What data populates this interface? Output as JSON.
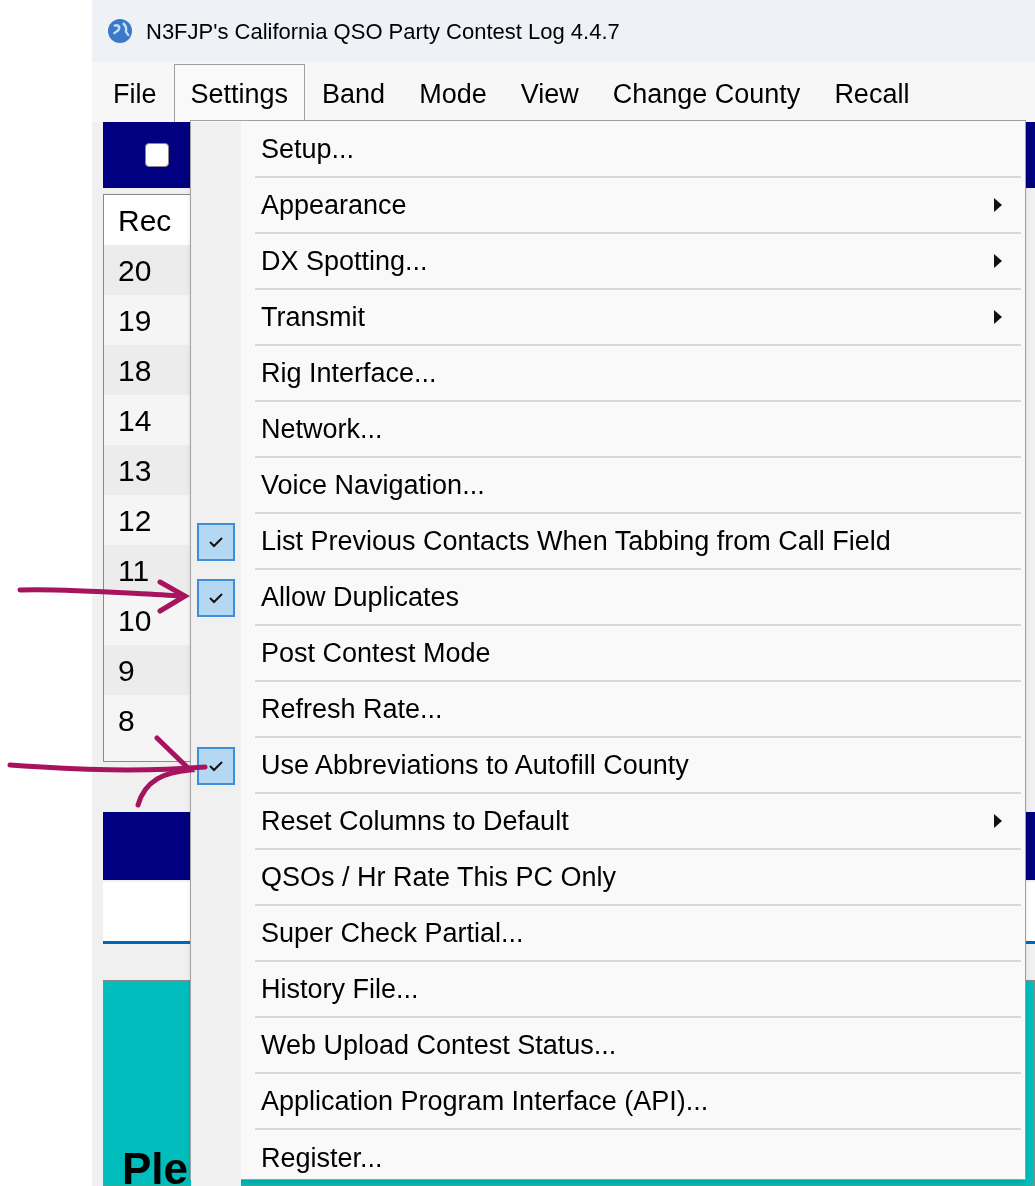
{
  "window": {
    "title": "N3FJP's California QSO Party Contest Log 4.4.7"
  },
  "menu_bar": [
    {
      "label": "File",
      "selected": false
    },
    {
      "label": "Settings",
      "selected": true
    },
    {
      "label": "Band",
      "selected": false
    },
    {
      "label": "Mode",
      "selected": false
    },
    {
      "label": "View",
      "selected": false
    },
    {
      "label": "Change County",
      "selected": false
    },
    {
      "label": "Recall",
      "selected": false
    }
  ],
  "header_bar": {
    "checkbox_checked": false
  },
  "log_table": {
    "column_header": "Rec",
    "rows": [
      "20",
      "19",
      "18",
      "14",
      "13",
      "12",
      "11",
      "10",
      "9",
      "8"
    ]
  },
  "message_panel": {
    "text": "Ple"
  },
  "settings_menu": [
    {
      "label": "Setup...",
      "checked": false,
      "submenu": false
    },
    {
      "label": "Appearance",
      "checked": false,
      "submenu": true
    },
    {
      "label": "DX Spotting...",
      "checked": false,
      "submenu": true
    },
    {
      "label": "Transmit",
      "checked": false,
      "submenu": true
    },
    {
      "label": "Rig Interface...",
      "checked": false,
      "submenu": false
    },
    {
      "label": "Network...",
      "checked": false,
      "submenu": false
    },
    {
      "label": "Voice Navigation...",
      "checked": false,
      "submenu": false
    },
    {
      "label": "List Previous Contacts When Tabbing from Call Field",
      "checked": true,
      "submenu": false
    },
    {
      "label": "Allow Duplicates",
      "checked": true,
      "submenu": false
    },
    {
      "label": "Post Contest Mode",
      "checked": false,
      "submenu": false
    },
    {
      "label": "Refresh Rate...",
      "checked": false,
      "submenu": false
    },
    {
      "label": "Use Abbreviations to Autofill County",
      "checked": true,
      "submenu": false
    },
    {
      "label": "Reset Columns to Default",
      "checked": false,
      "submenu": true
    },
    {
      "label": "QSOs / Hr Rate This PC Only",
      "checked": false,
      "submenu": false
    },
    {
      "label": "Super Check Partial...",
      "checked": false,
      "submenu": false
    },
    {
      "label": "History File...",
      "checked": false,
      "submenu": false
    },
    {
      "label": "Web Upload Contest Status...",
      "checked": false,
      "submenu": false
    },
    {
      "label": "Application Program Interface (API)...",
      "checked": false,
      "submenu": false
    },
    {
      "label": "Register...",
      "checked": false,
      "submenu": false
    }
  ]
}
